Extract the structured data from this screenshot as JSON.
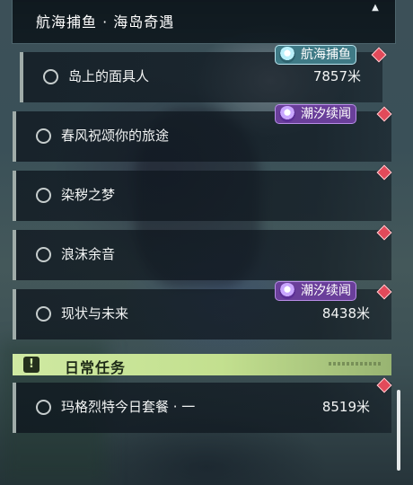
{
  "header": {
    "title": "航海捕鱼 · 海岛奇遇",
    "collapse_icon": "chevron-up-icon"
  },
  "quests": [
    {
      "name": "岛上的面具人",
      "distance": "7857米",
      "tag": "航海捕鱼",
      "tag_style": "teal"
    },
    {
      "name": "春风祝颂你的旅途",
      "distance": "",
      "tag": "潮汐续闻",
      "tag_style": "purple"
    },
    {
      "name": "染秽之梦",
      "distance": "",
      "tag": "",
      "tag_style": ""
    },
    {
      "name": "浪沫余音",
      "distance": "",
      "tag": "",
      "tag_style": ""
    },
    {
      "name": "现状与未来",
      "distance": "8438米",
      "tag": "潮汐续闻",
      "tag_style": "purple"
    }
  ],
  "daily_section": {
    "title": "日常任务",
    "icon": "exclamation-icon"
  },
  "daily_quests": [
    {
      "name": "玛格烈特今日套餐 · 一",
      "distance": "8519米"
    }
  ],
  "colors": {
    "marker": "#e24a5a",
    "tag_purple": "#6a3f9a",
    "tag_teal": "#3f7a86",
    "section_green": "#c3e08f"
  }
}
